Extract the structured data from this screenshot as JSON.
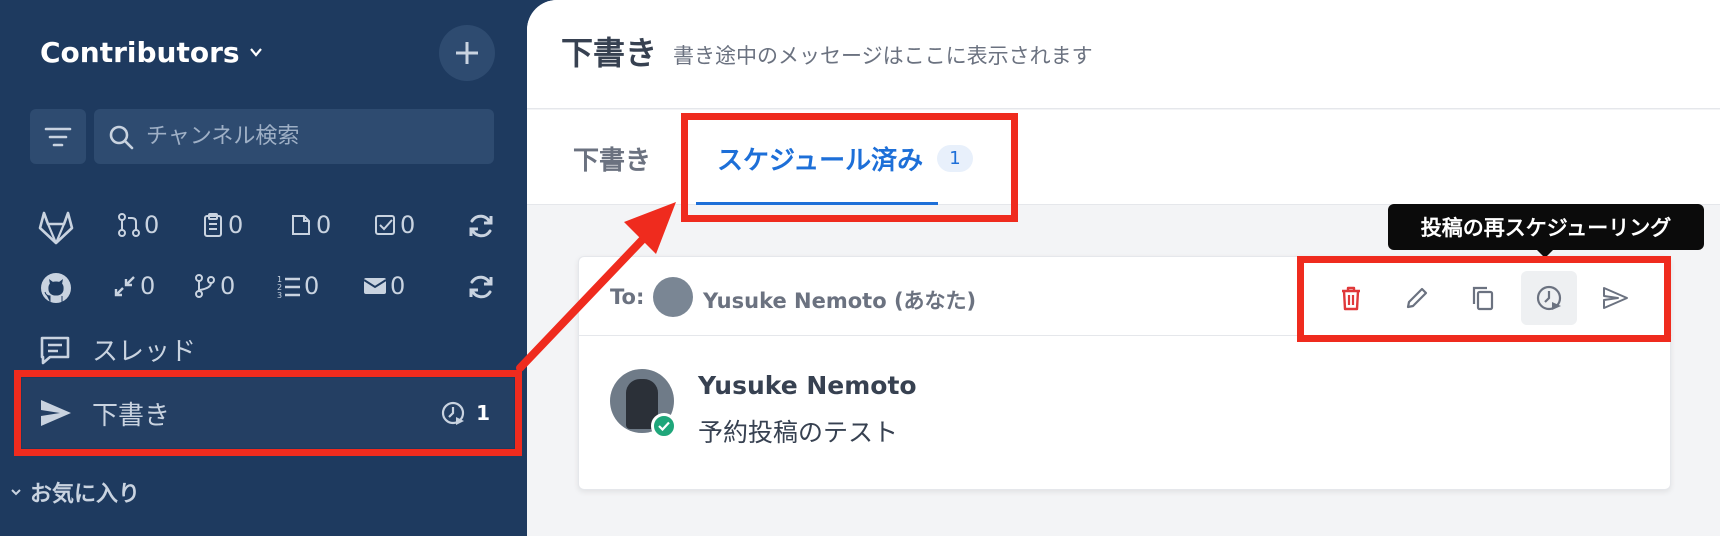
{
  "sidebar": {
    "team_name": "Contributors",
    "search_placeholder": "チャンネル検索",
    "gitlab_stats": [
      "0",
      "0",
      "0",
      "0"
    ],
    "github_stats": [
      "0",
      "0",
      "0",
      "0"
    ],
    "threads_label": "スレッド",
    "drafts_label": "下書き",
    "drafts_count": "1",
    "favorites_label": "お気に入り"
  },
  "header": {
    "title": "下書き",
    "subtitle": "書き途中のメッセージはここに表示されます"
  },
  "tabs": [
    {
      "label": "下書き"
    },
    {
      "label": "スケジュール済み",
      "count": "1"
    }
  ],
  "card": {
    "to_label": "To:",
    "to_name": "Yusuke Nemoto (あなた)",
    "author": "Yusuke Nemoto",
    "message": "予約投稿のテスト"
  },
  "tooltip": "投稿の再スケジューリング",
  "colors": {
    "sidebar_bg": "#1e3a5f",
    "accent": "#1d6fd8",
    "delete": "#e0383a",
    "highlight": "#ef2b1e"
  }
}
